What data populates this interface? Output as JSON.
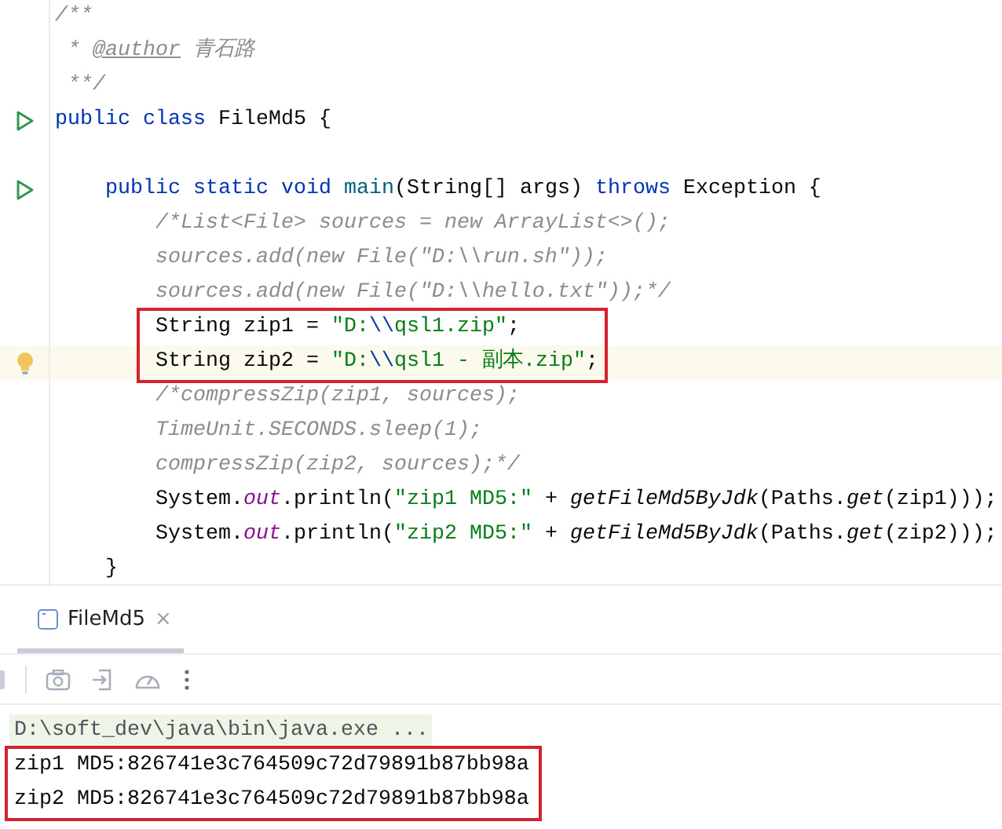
{
  "editor": {
    "lines": [
      {
        "run_marker": false,
        "bulb": false,
        "current": false,
        "boxed": false,
        "segments": [
          {
            "kind": "doc",
            "text": "/**"
          }
        ]
      },
      {
        "run_marker": false,
        "bulb": false,
        "current": false,
        "boxed": false,
        "segments": [
          {
            "kind": "doc",
            "text": " * "
          },
          {
            "kind": "doctag",
            "text": "@author"
          },
          {
            "kind": "doc",
            "text": " 青石路"
          }
        ]
      },
      {
        "run_marker": false,
        "bulb": false,
        "current": false,
        "boxed": false,
        "segments": [
          {
            "kind": "doc",
            "text": " **/"
          }
        ]
      },
      {
        "run_marker": true,
        "bulb": false,
        "current": false,
        "boxed": false,
        "segments": [
          {
            "kind": "keyword",
            "text": "public class "
          },
          {
            "kind": "plain",
            "text": "FileMd5 {"
          }
        ]
      },
      {
        "run_marker": false,
        "bulb": false,
        "current": false,
        "boxed": false
      },
      {
        "run_marker": true,
        "bulb": false,
        "current": false,
        "boxed": false,
        "segments": [
          {
            "kind": "keyword",
            "text": "    public static void "
          },
          {
            "kind": "method",
            "text": "main"
          },
          {
            "kind": "plain",
            "text": "(String[] args) "
          },
          {
            "kind": "keyword",
            "text": "throws "
          },
          {
            "kind": "plain",
            "text": "Exception {"
          }
        ]
      },
      {
        "run_marker": false,
        "bulb": false,
        "current": false,
        "boxed": false,
        "segments": [
          {
            "kind": "comment",
            "text": "        /*List<File> sources = new ArrayList<>();"
          }
        ]
      },
      {
        "run_marker": false,
        "bulb": false,
        "current": false,
        "boxed": false,
        "segments": [
          {
            "kind": "comment",
            "text": "        sources.add(new File(\"D:\\\\run.sh\"));"
          }
        ]
      },
      {
        "run_marker": false,
        "bulb": false,
        "current": false,
        "boxed": false,
        "segments": [
          {
            "kind": "comment",
            "text": "        sources.add(new File(\"D:\\\\hello.txt\"));*/"
          }
        ]
      },
      {
        "run_marker": false,
        "bulb": false,
        "current": false,
        "boxed": true,
        "segments": [
          {
            "kind": "plain",
            "text": "        String zip1 = "
          },
          {
            "kind": "string",
            "text": "\"D:"
          },
          {
            "kind": "escape",
            "text": "\\\\"
          },
          {
            "kind": "string",
            "text": "qsl1.zip\""
          },
          {
            "kind": "plain",
            "text": ";"
          }
        ]
      },
      {
        "run_marker": false,
        "bulb": true,
        "current": true,
        "boxed": true,
        "segments": [
          {
            "kind": "plain",
            "text": "        String zip2 = "
          },
          {
            "kind": "string",
            "text": "\"D:"
          },
          {
            "kind": "escape",
            "text": "\\\\"
          },
          {
            "kind": "string",
            "text": "qsl1 - 副本.zip\""
          },
          {
            "kind": "plain",
            "text": ";"
          }
        ]
      },
      {
        "run_marker": false,
        "bulb": false,
        "current": false,
        "boxed": false,
        "segments": [
          {
            "kind": "comment",
            "text": "        /*compressZip(zip1, sources);"
          }
        ]
      },
      {
        "run_marker": false,
        "bulb": false,
        "current": false,
        "boxed": false,
        "segments": [
          {
            "kind": "comment",
            "text": "        TimeUnit.SECONDS.sleep(1);"
          }
        ]
      },
      {
        "run_marker": false,
        "bulb": false,
        "current": false,
        "boxed": false,
        "segments": [
          {
            "kind": "comment",
            "text": "        compressZip(zip2, sources);*/"
          }
        ]
      },
      {
        "run_marker": false,
        "bulb": false,
        "current": false,
        "boxed": false,
        "segments": [
          {
            "kind": "plain",
            "text": "        System."
          },
          {
            "kind": "field",
            "text": "out"
          },
          {
            "kind": "plain",
            "text": ".println("
          },
          {
            "kind": "string",
            "text": "\"zip1 MD5:\""
          },
          {
            "kind": "plain",
            "text": " + "
          },
          {
            "kind": "static",
            "text": "getFileMd5ByJdk"
          },
          {
            "kind": "plain",
            "text": "(Paths."
          },
          {
            "kind": "static",
            "text": "get"
          },
          {
            "kind": "plain",
            "text": "(zip1)));"
          }
        ]
      },
      {
        "run_marker": false,
        "bulb": false,
        "current": false,
        "boxed": false,
        "segments": [
          {
            "kind": "plain",
            "text": "        System."
          },
          {
            "kind": "field",
            "text": "out"
          },
          {
            "kind": "plain",
            "text": ".println("
          },
          {
            "kind": "string",
            "text": "\"zip2 MD5:\""
          },
          {
            "kind": "plain",
            "text": " + "
          },
          {
            "kind": "static",
            "text": "getFileMd5ByJdk"
          },
          {
            "kind": "plain",
            "text": "(Paths."
          },
          {
            "kind": "static",
            "text": "get"
          },
          {
            "kind": "plain",
            "text": "(zip2)));"
          }
        ]
      },
      {
        "run_marker": false,
        "bulb": false,
        "current": false,
        "boxed": false,
        "segments": [
          {
            "kind": "plain",
            "text": "    }"
          }
        ]
      }
    ]
  },
  "run_panel": {
    "tabs": [
      {
        "label": "FileMd5",
        "close": "×",
        "selected": true
      }
    ],
    "output": [
      {
        "kind": "command",
        "boxed": false,
        "text": "D:\\soft_dev\\java\\bin\\java.exe ..."
      },
      {
        "kind": "stdout",
        "boxed": true,
        "text": "zip1 MD5:826741e3c764509c72d79891b87bb98a"
      },
      {
        "kind": "stdout",
        "boxed": true,
        "text": "zip2 MD5:826741e3c764509c72d79891b87bb98a"
      }
    ]
  }
}
